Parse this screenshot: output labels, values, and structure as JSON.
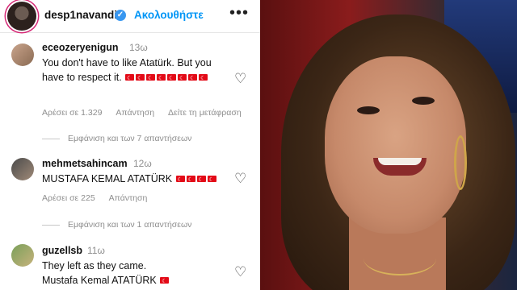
{
  "header": {
    "username": "desp1navandi",
    "follow_label": "Ακολουθήστε",
    "more_label": "•••"
  },
  "comments": [
    {
      "username": "eceozeryenigun",
      "time": "13ω",
      "text": "You don't have to like Atatürk. But you have to respect it.",
      "flags": 8,
      "likes": "Αρέσει σε 1.329",
      "reply_label": "Απάντηση",
      "translate_label": "Δείτε τη μετάφραση",
      "view_replies": "Εμφάνιση και των 7 απαντήσεων"
    },
    {
      "username": "mehmetsahincam",
      "time": "12ω",
      "text": "MUSTAFA KEMAL ATATÜRK",
      "flags": 4,
      "likes": "Αρέσει σε 225",
      "reply_label": "Απάντηση",
      "view_replies": "Εμφάνιση και των 1 απαντήσεων"
    },
    {
      "username": "guzellsb",
      "time": "11ω",
      "text_line1": "They left as they came.",
      "text_line2": "Mustafa Kemal ATATÜRK",
      "flags": 1
    }
  ],
  "icons": {
    "heart": "♡",
    "verified": "✓"
  },
  "colors": {
    "link_blue": "#0095f6",
    "flag_red": "#e30a17"
  }
}
